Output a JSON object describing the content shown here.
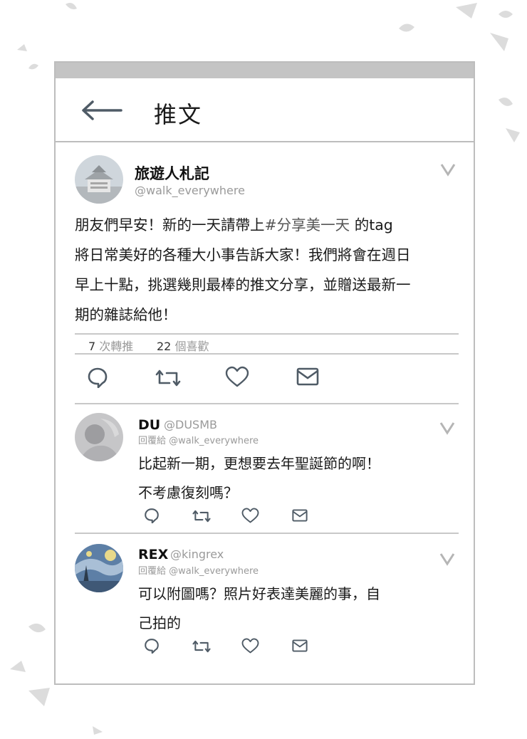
{
  "header": {
    "title": "推文"
  },
  "tweet": {
    "name": "旅遊人札記",
    "handle": "@walk_everywhere",
    "body_lines": [
      {
        "pre": "朋友們早安！新的一天請帶上",
        "tag": "#分享美一天",
        "post": " 的tag"
      },
      {
        "pre": "將日常美好的各種大小事告訴大家！我們將會在週日",
        "tag": "",
        "post": ""
      },
      {
        "pre": "早上十點，挑選幾則最棒的推文分享，並贈送最新一",
        "tag": "",
        "post": ""
      },
      {
        "pre": "期的雜誌給他！",
        "tag": "",
        "post": ""
      }
    ],
    "retweets_count": "7",
    "retweets_label": "次轉推",
    "likes_count": "22",
    "likes_label": "個喜歡"
  },
  "replies": [
    {
      "name": "DU",
      "handle": "@DUSMB",
      "reply_to": "回覆給 @walk_everywhere",
      "lines": [
        "比起新一期，更想要去年聖誕節的啊！",
        "不考慮復刻嗎？"
      ]
    },
    {
      "name": "REX",
      "handle": "@kingrex",
      "reply_to": "回覆給 @walk_everywhere",
      "lines": [
        "可以附圖嗎？照片好表達美麗的事，自",
        "己拍的"
      ]
    }
  ],
  "icons": {
    "back": "arrow-left-icon",
    "reply": "reply-bubble-icon",
    "retweet": "retweet-icon",
    "like": "heart-icon",
    "dm": "envelope-icon",
    "menu": "chevron-down-icon"
  },
  "colors": {
    "icon": "#4f5b66",
    "border": "#bdbdbd",
    "muted": "#9a9a9a"
  }
}
